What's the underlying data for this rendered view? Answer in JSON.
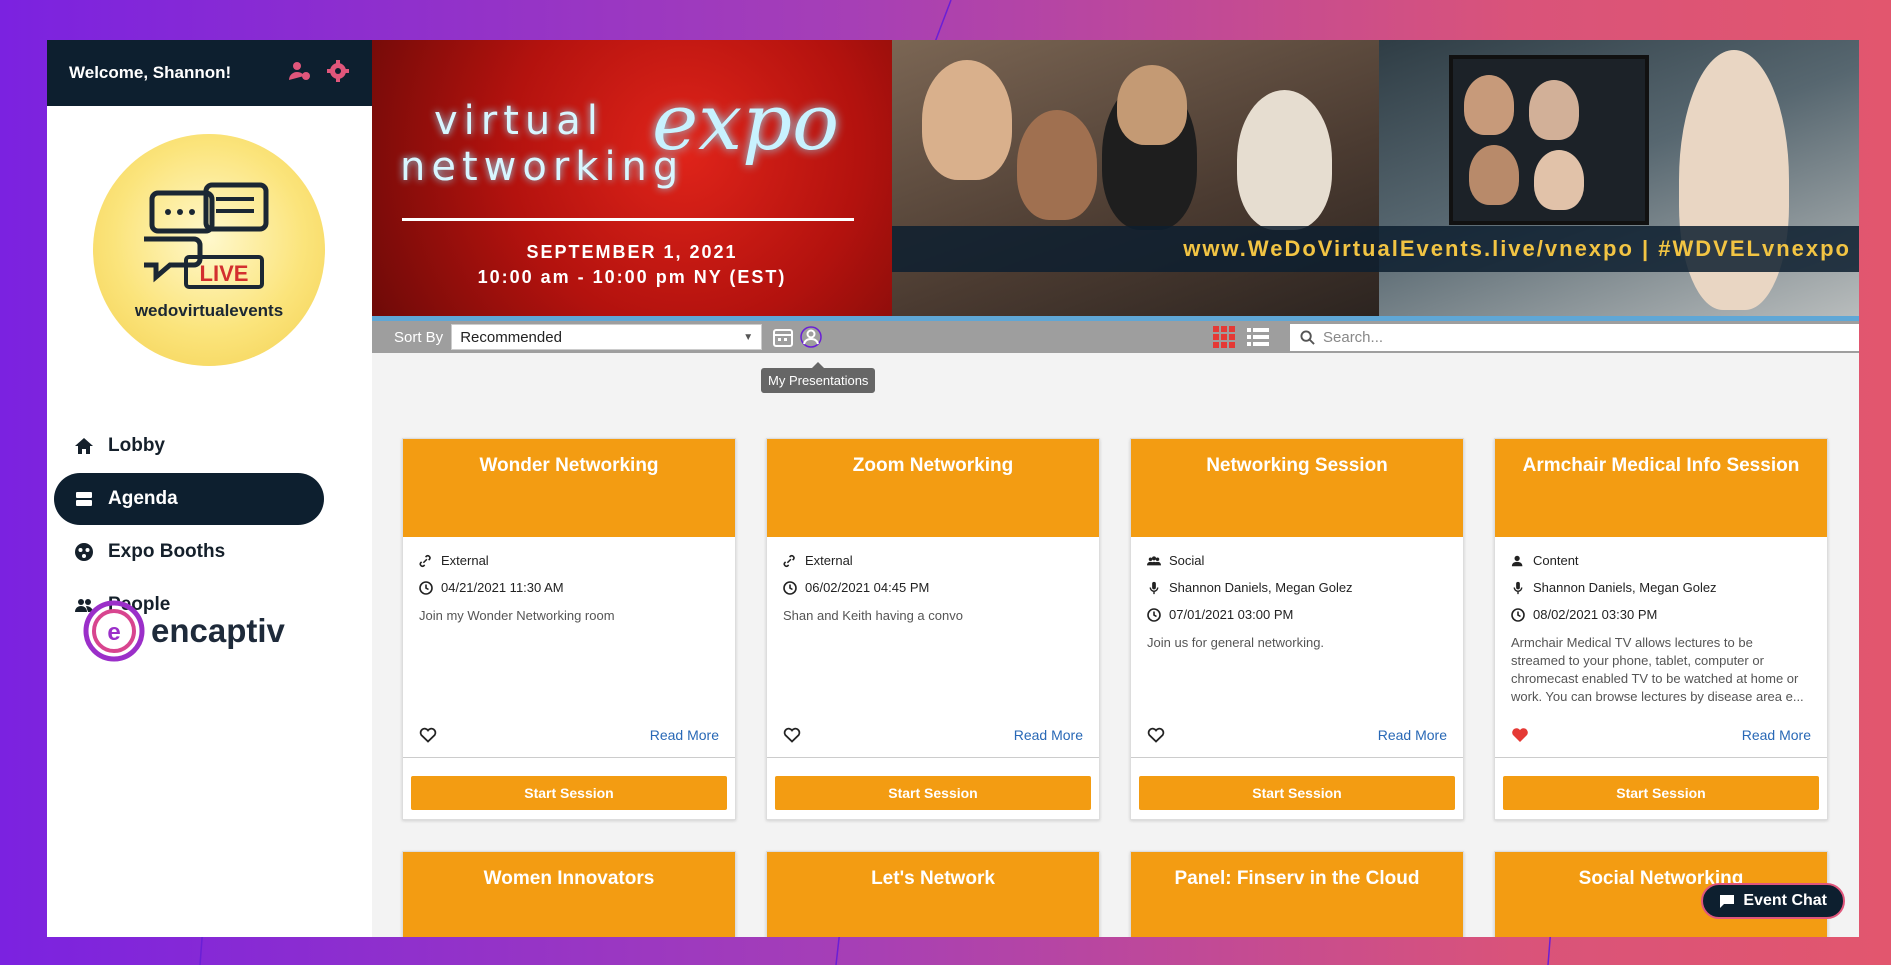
{
  "sidebar": {
    "welcome": "Welcome, Shannon!",
    "logo_text": "wedovirtualevents",
    "logo_badge": "LIVE",
    "nav": [
      {
        "label": "Lobby",
        "icon": "home-icon"
      },
      {
        "label": "Agenda",
        "icon": "agenda-icon"
      },
      {
        "label": "Expo Booths",
        "icon": "booth-icon"
      },
      {
        "label": "People",
        "icon": "people-icon"
      }
    ],
    "brand": "encaptiv",
    "brand_letter": "e"
  },
  "banner": {
    "word1": "virtual",
    "word2": "expo",
    "word3": "networking",
    "date": "SEPTEMBER 1, 2021",
    "time": "10:00 am - 10:00 pm NY (EST)",
    "url": "www.WeDoVirtualEvents.live/vnexpo | #WDVELvnexpo"
  },
  "toolbar": {
    "sort_label": "Sort By",
    "sort_value": "Recommended",
    "search_placeholder": "Search...",
    "tooltip": "My Presentations"
  },
  "cards": [
    {
      "title": "Wonder Networking",
      "type": "External",
      "type_icon": "link-icon",
      "speakers": "",
      "datetime": "04/21/2021 11:30 AM",
      "desc": "Join my Wonder Networking room",
      "favorited": false,
      "read_more": "Read More",
      "button": "Start Session"
    },
    {
      "title": "Zoom Networking",
      "type": "External",
      "type_icon": "link-icon",
      "speakers": "",
      "datetime": "06/02/2021 04:45 PM",
      "desc": "Shan and Keith having a convo",
      "favorited": false,
      "read_more": "Read More",
      "button": "Start Session"
    },
    {
      "title": "Networking Session",
      "type": "Social",
      "type_icon": "group-icon",
      "speakers": "Shannon Daniels, Megan Golez",
      "datetime": "07/01/2021 03:00 PM",
      "desc": "Join us for general networking.",
      "favorited": false,
      "read_more": "Read More",
      "button": "Start Session"
    },
    {
      "title": "Armchair Medical Info Session",
      "type": "Content",
      "type_icon": "person-icon",
      "speakers": "Shannon Daniels, Megan Golez",
      "datetime": "08/02/2021 03:30 PM",
      "desc": "Armchair Medical TV allows lectures to be streamed to your phone, tablet, computer or chromecast enabled TV to be watched at home or work. You can browse lectures by disease area e...",
      "favorited": true,
      "read_more": "Read More",
      "button": "Start Session"
    }
  ],
  "cards_row2": [
    "Women Innovators",
    "Let's Network",
    "Panel: Finserv in the Cloud",
    "Social Networking"
  ],
  "event_chat": "Event Chat",
  "colors": {
    "accent": "#f39c12",
    "navy": "#0d1f2f",
    "pink": "#e0567b",
    "heart": "#e53935"
  }
}
